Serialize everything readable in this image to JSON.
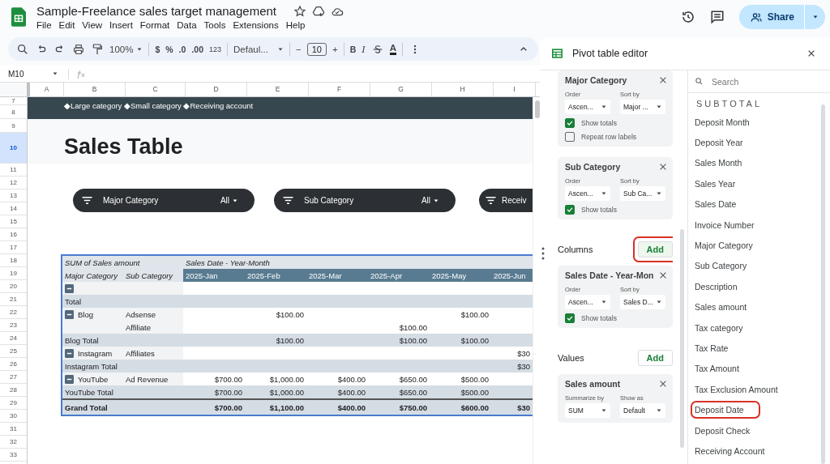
{
  "document": {
    "title": "Sample-Freelance sales target management"
  },
  "menu": [
    "File",
    "Edit",
    "View",
    "Insert",
    "Format",
    "Data",
    "Tools",
    "Extensions",
    "Help"
  ],
  "share": {
    "label": "Share"
  },
  "toolbar": {
    "zoom": "100%",
    "currency": "$",
    "percent": "%",
    "decrease_decimals": ".0",
    "increase_decimals": ".00",
    "number_format": "123",
    "font": "Defaul...",
    "minus": "−",
    "font_size": "10",
    "plus": "+",
    "bold": "B",
    "italic": "I",
    "text_color": "A"
  },
  "formula_bar": {
    "cell": "M10"
  },
  "columns": [
    "A",
    "B",
    "C",
    "D",
    "E",
    "F",
    "G",
    "H",
    "I"
  ],
  "rows": [
    {
      "label": "7",
      "selected": false
    },
    {
      "label": "8",
      "selected": false
    },
    {
      "label": "9",
      "selected": false
    },
    {
      "label": "10",
      "selected": true
    },
    {
      "label": "11",
      "selected": false
    },
    {
      "label": "12",
      "selected": false
    },
    {
      "label": "13",
      "selected": false
    },
    {
      "label": "14",
      "selected": false
    },
    {
      "label": "15",
      "selected": false
    },
    {
      "label": "16",
      "selected": false
    },
    {
      "label": "17",
      "selected": false
    },
    {
      "label": "18",
      "selected": false
    },
    {
      "label": "19",
      "selected": false
    },
    {
      "label": "20",
      "selected": false
    },
    {
      "label": "21",
      "selected": false
    },
    {
      "label": "22",
      "selected": false
    },
    {
      "label": "23",
      "selected": false
    },
    {
      "label": "24",
      "selected": false
    },
    {
      "label": "25",
      "selected": false
    },
    {
      "label": "26",
      "selected": false
    },
    {
      "label": "27",
      "selected": false
    },
    {
      "label": "28",
      "selected": false
    },
    {
      "label": "29",
      "selected": false
    },
    {
      "label": "30",
      "selected": false
    },
    {
      "label": "31",
      "selected": false
    },
    {
      "label": "32",
      "selected": false
    },
    {
      "label": "33",
      "selected": false
    }
  ],
  "sheet": {
    "banner": "◆Large category ◆Small category ◆Receiving account",
    "heading": "Sales Table",
    "filters": [
      {
        "label": "Major Category",
        "value": "All"
      },
      {
        "label": "Sub Category",
        "value": "All"
      },
      {
        "label": "Receiv"
      }
    ]
  },
  "pivot": {
    "value_label": "SUM of Sales amount",
    "column_field": "Sales Date - Year-Month",
    "row_fields": [
      "Major Category",
      "Sub Category"
    ],
    "months": [
      "2025-Jan",
      "2025-Feb",
      "2025-Mar",
      "2025-Apr",
      "2025-May",
      "2025-Jun"
    ],
    "rows": [
      {
        "kind": "item",
        "collapsible": true,
        "values": [
          {
            "kind": "blank"
          },
          {
            "kind": "blank"
          },
          {
            "kind": "blank"
          },
          {
            "kind": "blank"
          },
          {
            "kind": "blank"
          },
          {
            "kind": "blank"
          }
        ]
      },
      {
        "kind": "total",
        "major": "Total",
        "values": [
          {
            "kind": "blank"
          },
          {
            "kind": "blank"
          },
          {
            "kind": "blank"
          },
          {
            "kind": "blank"
          },
          {
            "kind": "blank"
          },
          {
            "kind": "blank"
          }
        ]
      },
      {
        "kind": "item",
        "collapsible": true,
        "major": "Blog",
        "sub": "Adsense",
        "values": [
          {
            "kind": "blank"
          },
          {
            "kind": "amount",
            "text": "$100.00"
          },
          {
            "kind": "blank"
          },
          {
            "kind": "blank"
          },
          {
            "kind": "amount",
            "text": "$100.00"
          },
          {
            "kind": "blank"
          }
        ]
      },
      {
        "kind": "item",
        "collapsible": false,
        "sub": "Affiliate",
        "values": [
          {
            "kind": "blank"
          },
          {
            "kind": "blank"
          },
          {
            "kind": "blank"
          },
          {
            "kind": "amount",
            "text": "$100.00"
          },
          {
            "kind": "blank"
          },
          {
            "kind": "blank"
          }
        ]
      },
      {
        "kind": "total",
        "major": "Blog Total",
        "values": [
          {
            "kind": "blank"
          },
          {
            "kind": "amount",
            "text": "$100.00"
          },
          {
            "kind": "blank"
          },
          {
            "kind": "amount",
            "text": "$100.00"
          },
          {
            "kind": "amount",
            "text": "$100.00"
          },
          {
            "kind": "blank"
          }
        ]
      },
      {
        "kind": "item",
        "collapsible": true,
        "major": "Instagram",
        "sub": "Affiliates",
        "values": [
          {
            "kind": "blank"
          },
          {
            "kind": "blank"
          },
          {
            "kind": "blank"
          },
          {
            "kind": "blank"
          },
          {
            "kind": "blank"
          },
          {
            "kind": "amount",
            "text": "$30"
          }
        ]
      },
      {
        "kind": "total",
        "major": "Instagram Total",
        "values": [
          {
            "kind": "blank"
          },
          {
            "kind": "blank"
          },
          {
            "kind": "blank"
          },
          {
            "kind": "blank"
          },
          {
            "kind": "blank"
          },
          {
            "kind": "amount",
            "text": "$30"
          }
        ]
      },
      {
        "kind": "item",
        "collapsible": true,
        "major": "YouTube",
        "sub": "Ad Revenue",
        "values": [
          {
            "kind": "amount",
            "text": "$700.00"
          },
          {
            "kind": "amount",
            "text": "$1,000.00"
          },
          {
            "kind": "amount",
            "text": "$400.00"
          },
          {
            "kind": "amount",
            "text": "$650.00"
          },
          {
            "kind": "amount",
            "text": "$500.00"
          },
          {
            "kind": "blank"
          }
        ]
      },
      {
        "kind": "total",
        "major": "YouTube Total",
        "values": [
          {
            "kind": "amount",
            "text": "$700.00"
          },
          {
            "kind": "amount",
            "text": "$1,000.00"
          },
          {
            "kind": "amount",
            "text": "$400.00"
          },
          {
            "kind": "amount",
            "text": "$650.00"
          },
          {
            "kind": "amount",
            "text": "$500.00"
          },
          {
            "kind": "blank"
          }
        ]
      },
      {
        "kind": "grand",
        "major": "Grand Total",
        "values": [
          {
            "kind": "amount",
            "text": "$700.00"
          },
          {
            "kind": "amount",
            "text": "$1,100.00"
          },
          {
            "kind": "amount",
            "text": "$400.00"
          },
          {
            "kind": "amount",
            "text": "$750.00"
          },
          {
            "kind": "amount",
            "text": "$600.00"
          },
          {
            "kind": "amount",
            "text": "$30"
          }
        ]
      }
    ]
  },
  "editor": {
    "title": "Pivot table editor",
    "sections": [
      {
        "cards": [
          {
            "title": "Major Category",
            "selects": [
              {
                "label": "Order",
                "value": "Ascen..."
              },
              {
                "label": "Sort by",
                "value": "Major ..."
              }
            ],
            "checkboxes": [
              {
                "label": "Show totals",
                "checked": true
              },
              {
                "label": "Repeat row labels",
                "checked": false
              }
            ]
          },
          {
            "title": "Sub Category",
            "selects": [
              {
                "label": "Order",
                "value": "Ascen..."
              },
              {
                "label": "Sort by",
                "value": "Sub Ca..."
              }
            ],
            "checkboxes": [
              {
                "label": "Show totals",
                "checked": true
              }
            ]
          }
        ]
      },
      {
        "title": "Columns",
        "add": "Add",
        "circled": true,
        "cards": [
          {
            "title": "Sales Date - Year-Mon",
            "selects": [
              {
                "label": "Order",
                "value": "Ascen..."
              },
              {
                "label": "Sort by",
                "value": "Sales D..."
              }
            ],
            "checkboxes": [
              {
                "label": "Show totals",
                "checked": true
              }
            ]
          }
        ]
      },
      {
        "title": "Values",
        "add": "Add",
        "circled": false,
        "cards": [
          {
            "title": "Sales amount",
            "selects": [
              {
                "label": "Summarize by",
                "value": "SUM"
              },
              {
                "label": "Show as",
                "value": "Default"
              }
            ]
          }
        ]
      }
    ],
    "search": {
      "placeholder": "Search"
    },
    "fields_heading": "SUBTOTAL",
    "fields": [
      {
        "label": "Deposit Month",
        "circled": false
      },
      {
        "label": "Deposit Year",
        "circled": false
      },
      {
        "label": "Sales Month",
        "circled": false
      },
      {
        "label": "Sales Year",
        "circled": false
      },
      {
        "label": "Sales Date",
        "circled": false
      },
      {
        "label": "Invoice Number",
        "circled": false
      },
      {
        "label": "Major Category",
        "circled": false
      },
      {
        "label": "Sub Category",
        "circled": false
      },
      {
        "label": "Description",
        "circled": false
      },
      {
        "label": "Sales amount",
        "circled": false
      },
      {
        "label": "Tax category",
        "circled": false
      },
      {
        "label": "Tax Rate",
        "circled": false
      },
      {
        "label": "Tax Amount",
        "circled": false
      },
      {
        "label": "Tax Exclusion Amount",
        "circled": false
      },
      {
        "label": "Deposit Date",
        "circled": true
      },
      {
        "label": "Deposit Check",
        "circled": false
      },
      {
        "label": "Receiving Account",
        "circled": false
      }
    ]
  }
}
